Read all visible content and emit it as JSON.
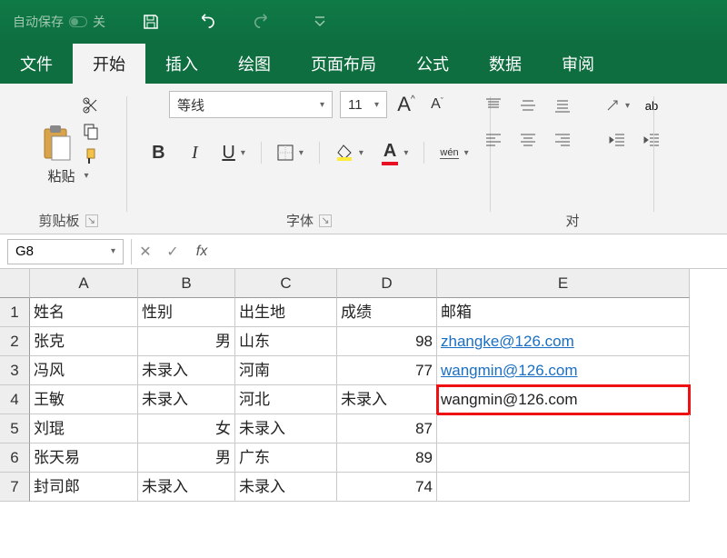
{
  "titlebar": {
    "autosave_label": "自动保存",
    "autosave_state": "关"
  },
  "tabs": [
    "文件",
    "开始",
    "插入",
    "绘图",
    "页面布局",
    "公式",
    "数据",
    "审阅"
  ],
  "active_tab": 1,
  "ribbon": {
    "clipboard": {
      "paste_label": "粘贴",
      "group_label": "剪贴板"
    },
    "font": {
      "name": "等线",
      "size": "11",
      "grow_label": "A",
      "shrink_label": "A",
      "bold": "B",
      "italic": "I",
      "underline": "U",
      "wen": "wén",
      "group_label": "字体"
    },
    "alignment": {
      "group_label": "对"
    }
  },
  "formula_bar": {
    "name_box": "G8",
    "fx": "fx",
    "value": ""
  },
  "sheet": {
    "columns": [
      "A",
      "B",
      "C",
      "D",
      "E"
    ],
    "rows": [
      {
        "n": "1",
        "A": "姓名",
        "B": "性别",
        "C": "出生地",
        "D": "成绩",
        "E": "邮箱"
      },
      {
        "n": "2",
        "A": "张克",
        "B": "男",
        "B_align": "r",
        "C": "山东",
        "D": "98",
        "D_align": "r",
        "E": "zhangke@126.com",
        "E_link": true
      },
      {
        "n": "3",
        "A": "冯风",
        "B": "未录入",
        "C": "河南",
        "D": "77",
        "D_align": "r",
        "E": "wangmin@126.com",
        "E_link": true
      },
      {
        "n": "4",
        "A": "王敏",
        "B": "未录入",
        "C": "河北",
        "D": "未录入",
        "E": "wangmin@126.com",
        "E_highlight": true
      },
      {
        "n": "5",
        "A": "刘琨",
        "B": "女",
        "B_align": "r",
        "C": "未录入",
        "D": "87",
        "D_align": "r",
        "E": ""
      },
      {
        "n": "6",
        "A": "张天易",
        "B": "男",
        "B_align": "r",
        "C": "广东",
        "D": "89",
        "D_align": "r",
        "E": ""
      },
      {
        "n": "7",
        "A": "封司郎",
        "B": "未录入",
        "C": "未录入",
        "D": "74",
        "D_align": "r",
        "E": ""
      }
    ]
  }
}
